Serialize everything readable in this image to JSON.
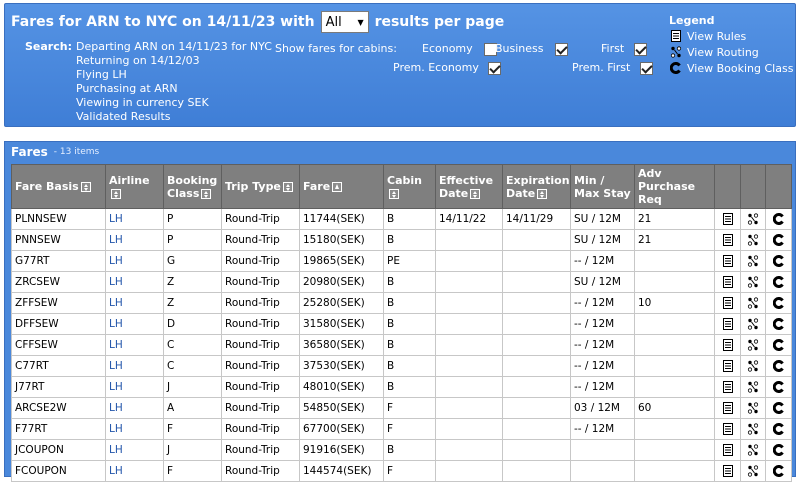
{
  "header": {
    "title_prefix": "Fares for ARN to NYC on 14/11/23 with",
    "per_page_value": "All",
    "title_suffix": "results per page",
    "search_label": "Search:",
    "search_lines": [
      "Departing ARN on 14/11/23 for NYC",
      "Returning on 14/12/03",
      "Flying LH",
      "Purchasing at ARN",
      "Viewing in currency SEK",
      "Validated Results"
    ],
    "cabins_label": "Show fares for cabins:",
    "cabins": [
      {
        "label": "Economy",
        "checked": false
      },
      {
        "label": "Business",
        "checked": true
      },
      {
        "label": "First",
        "checked": true
      },
      {
        "label": "Prem. Economy",
        "checked": true
      },
      {
        "label": "Prem. First",
        "checked": true
      }
    ]
  },
  "legend": {
    "title": "Legend",
    "items": [
      {
        "label": "View Rules",
        "icon": "rules-icon"
      },
      {
        "label": "View Routing",
        "icon": "routing-icon"
      },
      {
        "label": "View Booking Class",
        "icon": "booking-class-icon"
      }
    ]
  },
  "fares": {
    "title": "Fares",
    "count": "- 13 items",
    "columns": [
      "Fare Basis",
      "Airline",
      "Booking Class",
      "Trip Type",
      "Fare",
      "Cabin",
      "Effective Date",
      "Expiration Date",
      "Min / Max Stay",
      "Adv Purchase Req"
    ],
    "rows": [
      [
        "PLNNSEW",
        "LH",
        "P",
        "Round-Trip",
        "11744(SEK)",
        "B",
        "14/11/22",
        "14/11/29",
        "SU / 12M",
        "21"
      ],
      [
        "PNNSEW",
        "LH",
        "P",
        "Round-Trip",
        "15180(SEK)",
        "B",
        "",
        "",
        "SU / 12M",
        "21"
      ],
      [
        "G77RT",
        "LH",
        "G",
        "Round-Trip",
        "19865(SEK)",
        "PE",
        "",
        "",
        "-- / 12M",
        ""
      ],
      [
        "ZRCSEW",
        "LH",
        "Z",
        "Round-Trip",
        "20980(SEK)",
        "B",
        "",
        "",
        "SU / 12M",
        ""
      ],
      [
        "ZFFSEW",
        "LH",
        "Z",
        "Round-Trip",
        "25280(SEK)",
        "B",
        "",
        "",
        "-- / 12M",
        "10"
      ],
      [
        "DFFSEW",
        "LH",
        "D",
        "Round-Trip",
        "31580(SEK)",
        "B",
        "",
        "",
        "-- / 12M",
        ""
      ],
      [
        "CFFSEW",
        "LH",
        "C",
        "Round-Trip",
        "36580(SEK)",
        "B",
        "",
        "",
        "-- / 12M",
        ""
      ],
      [
        "C77RT",
        "LH",
        "C",
        "Round-Trip",
        "37530(SEK)",
        "B",
        "",
        "",
        "-- / 12M",
        ""
      ],
      [
        "J77RT",
        "LH",
        "J",
        "Round-Trip",
        "48010(SEK)",
        "B",
        "",
        "",
        "-- / 12M",
        ""
      ],
      [
        "ARCSE2W",
        "LH",
        "A",
        "Round-Trip",
        "54850(SEK)",
        "F",
        "",
        "",
        "03 / 12M",
        "60"
      ],
      [
        "F77RT",
        "LH",
        "F",
        "Round-Trip",
        "67700(SEK)",
        "F",
        "",
        "",
        "-- / 12M",
        ""
      ],
      [
        "JCOUPON",
        "LH",
        "J",
        "Round-Trip",
        "91916(SEK)",
        "B",
        "",
        "",
        "",
        ""
      ],
      [
        "FCOUPON",
        "LH",
        "F",
        "Round-Trip",
        "144574(SEK)",
        "F",
        "",
        "",
        "",
        ""
      ]
    ]
  }
}
